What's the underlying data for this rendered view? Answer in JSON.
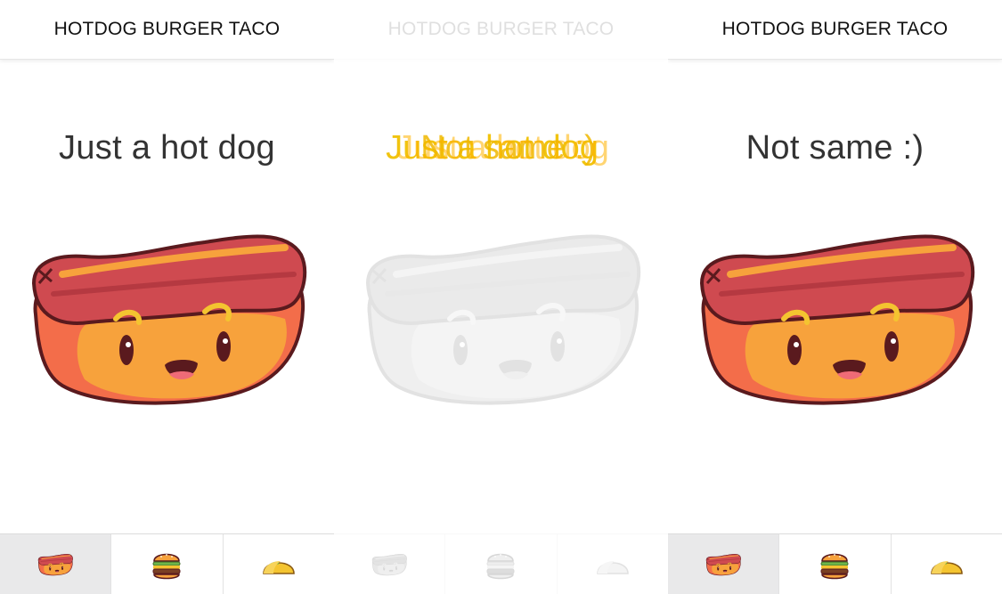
{
  "app": {
    "title": "HOTDOG BURGER TACO"
  },
  "screens": [
    {
      "headline": "Just a hot dog"
    },
    {
      "headline_out": "Just a hot dog",
      "headline_in": "Not same :)"
    },
    {
      "headline": "Not same :)"
    }
  ],
  "tabs": [
    {
      "name": "hotdog",
      "icon": "hotdog-icon"
    },
    {
      "name": "burger",
      "icon": "burger-icon"
    },
    {
      "name": "taco",
      "icon": "taco-icon"
    }
  ],
  "colors": {
    "sausage": "#cf4a50",
    "bun": "#f7a23c",
    "outline": "#5a1a1e",
    "transition_text": "#f1c40f"
  }
}
